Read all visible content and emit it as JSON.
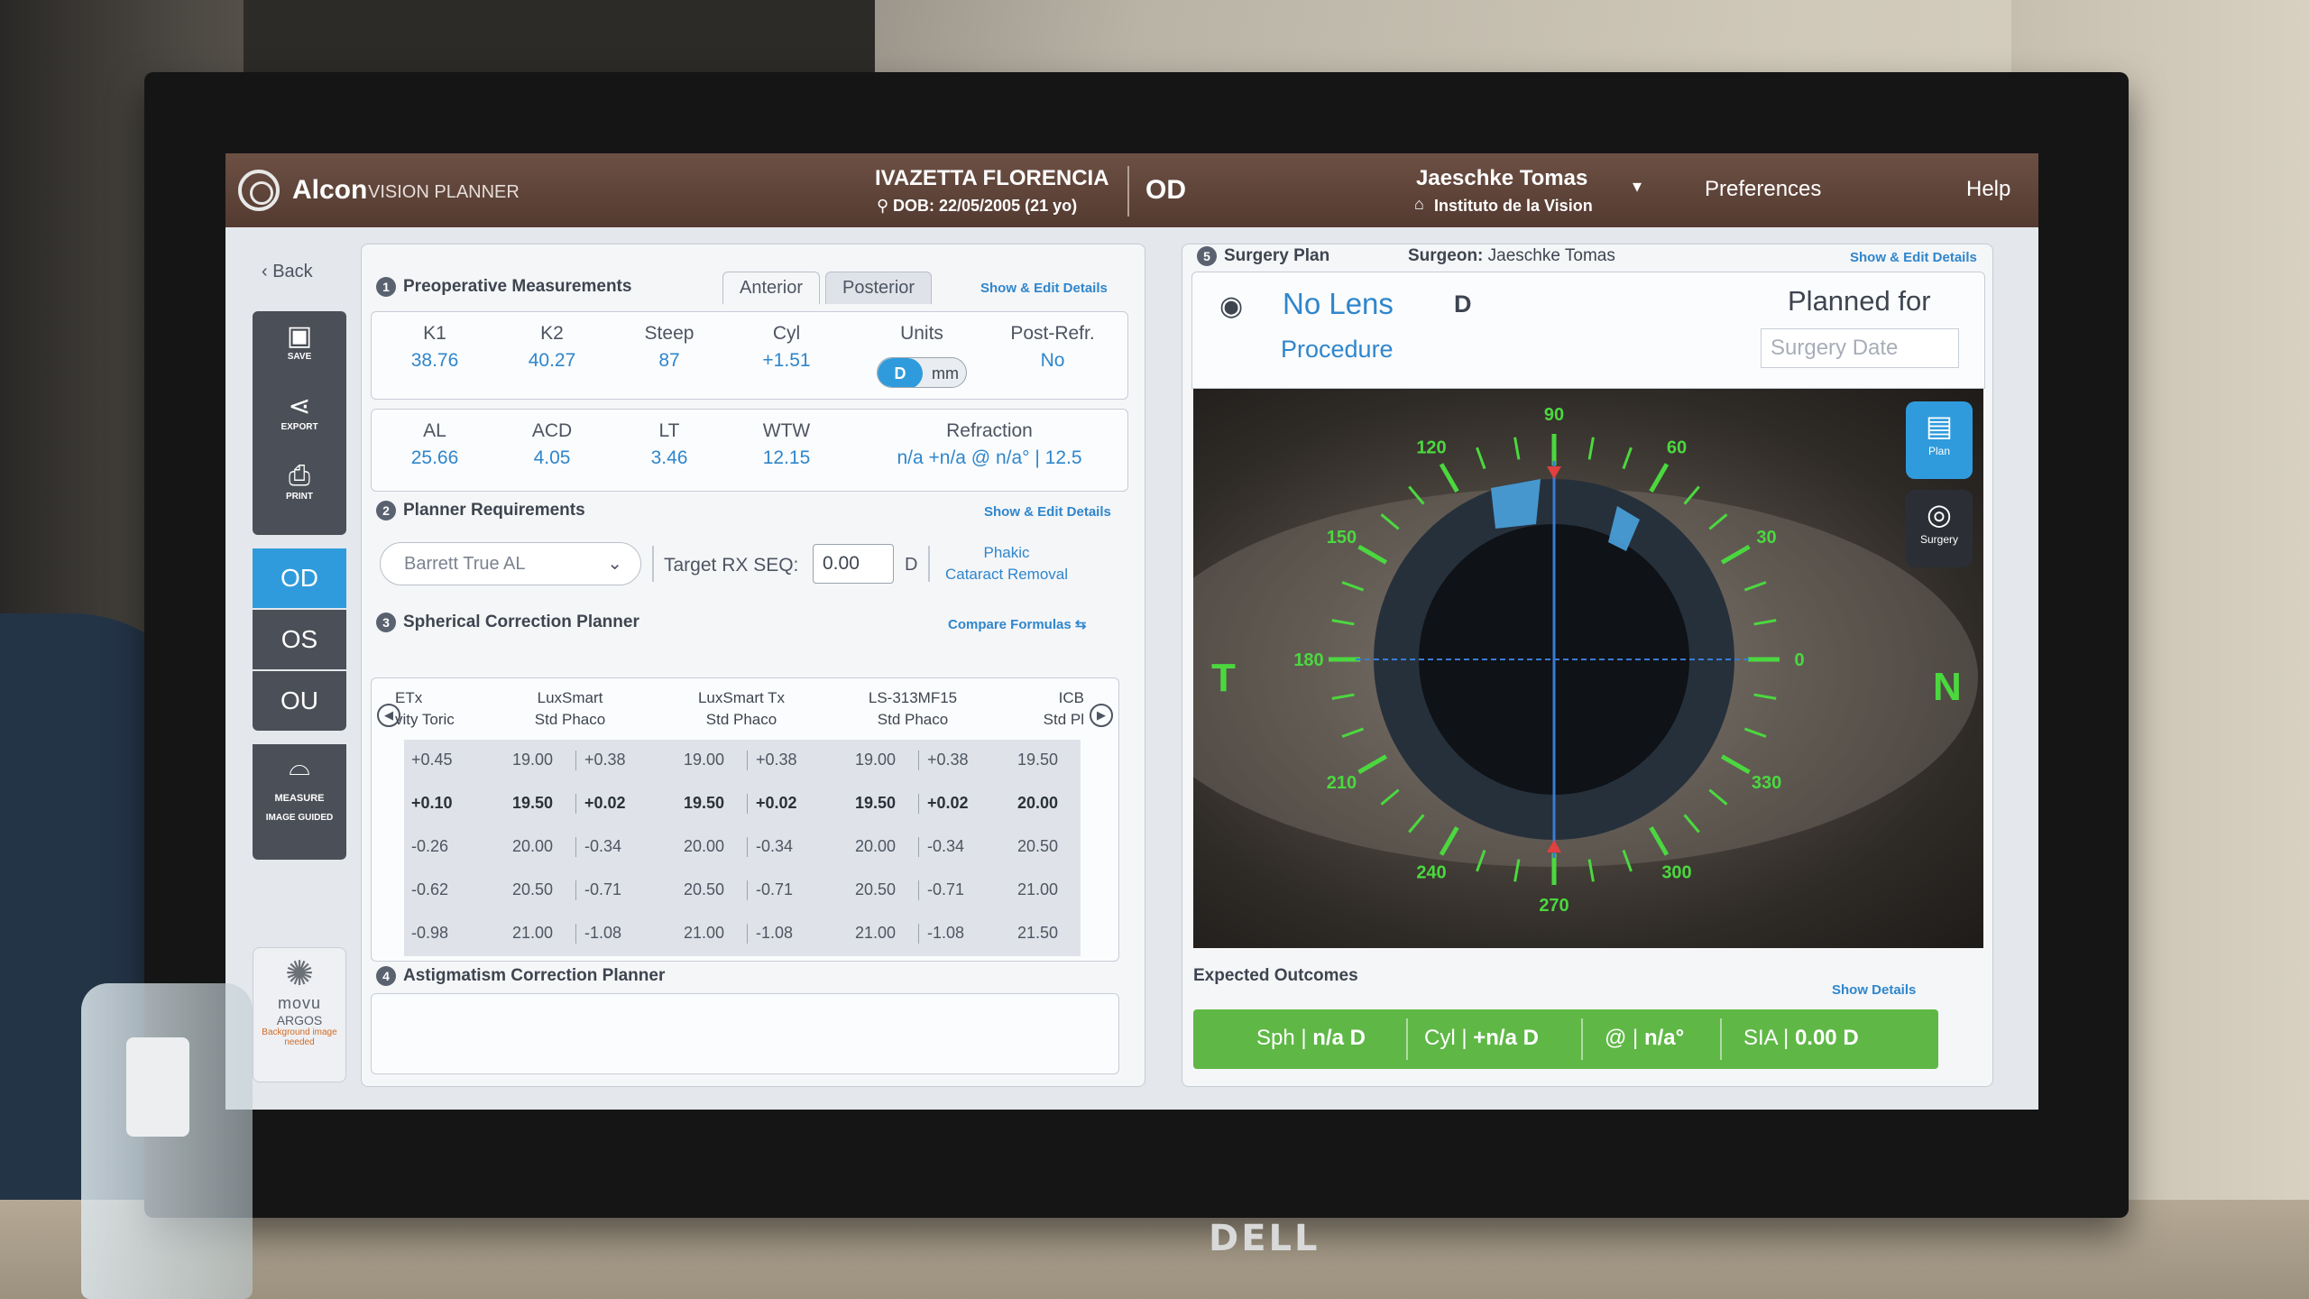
{
  "header": {
    "brand": "Alcon",
    "brand_sub": "VISION PLANNER",
    "patient_name": "IVAZETTA FLORENCIA",
    "patient_dob": "DOB: 22/05/2005 (21 yo)",
    "eye": "OD",
    "surgeon": "Jaeschke Tomas",
    "institute": "Instituto de la Vision",
    "preferences": "Preferences",
    "help": "Help"
  },
  "sidebar": {
    "back": "Back",
    "tools": [
      {
        "label": "SAVE",
        "icon": "save-icon"
      },
      {
        "label": "EXPORT",
        "icon": "share-icon"
      },
      {
        "label": "PRINT",
        "icon": "print-icon"
      }
    ],
    "eyes": [
      "OD",
      "OS",
      "OU"
    ],
    "measure_label": "MEASURE",
    "image_guided_label": "IMAGE GUIDED",
    "movu_name": "movu",
    "movu_sub": "ARGOS",
    "movu_note": "Background image needed"
  },
  "preop": {
    "num": "1",
    "title": "Preoperative Measurements",
    "tabs": [
      "Anterior",
      "Posterior"
    ],
    "link": "Show & Edit Details",
    "row1": [
      {
        "h": "K1",
        "v": "38.76"
      },
      {
        "h": "K2",
        "v": "40.27"
      },
      {
        "h": "Steep",
        "v": "87"
      },
      {
        "h": "Cyl",
        "v": "+1.51"
      },
      {
        "h": "Units",
        "v": ""
      },
      {
        "h": "Post-Refr.",
        "v": "No"
      }
    ],
    "units": {
      "d": "D",
      "mm": "mm"
    },
    "row2": [
      {
        "h": "AL",
        "v": "25.66"
      },
      {
        "h": "ACD",
        "v": "4.05"
      },
      {
        "h": "LT",
        "v": "3.46"
      },
      {
        "h": "WTW",
        "v": "12.15"
      },
      {
        "h": "Refraction",
        "v": "n/a +n/a @ n/a° | 12.5"
      }
    ]
  },
  "planner": {
    "num": "2",
    "title": "Planner Requirements",
    "link": "Show & Edit Details",
    "formula": "Barrett True AL",
    "target_label": "Target RX SEQ:",
    "target_value": "0.00",
    "target_unit": "D",
    "phakic_1": "Phakic",
    "phakic_2": "Cataract Removal"
  },
  "spherical": {
    "num": "3",
    "title": "Spherical Correction Planner",
    "link": "Compare Formulas",
    "headers": [
      [
        "ETx",
        "vity Toric"
      ],
      [
        "LuxSmart",
        "Std Phaco"
      ],
      [
        "LuxSmart Tx",
        "Std Phaco"
      ],
      [
        "LS-313MF15",
        "Std Phaco"
      ],
      [
        "ICB",
        "Std Pl"
      ]
    ],
    "rows": [
      {
        "c0": "+0.45",
        "c1a": "19.00",
        "c1b": "+0.38",
        "c2a": "19.00",
        "c2b": "+0.38",
        "c3a": "19.00",
        "c3b": "+0.38",
        "c4": "19.50"
      },
      {
        "c0": "+0.10",
        "c1a": "19.50",
        "c1b": "+0.02",
        "c2a": "19.50",
        "c2b": "+0.02",
        "c3a": "19.50",
        "c3b": "+0.02",
        "c4": "20.00"
      },
      {
        "c0": "-0.26",
        "c1a": "20.00",
        "c1b": "-0.34",
        "c2a": "20.00",
        "c2b": "-0.34",
        "c3a": "20.00",
        "c3b": "-0.34",
        "c4": "20.50"
      },
      {
        "c0": "-0.62",
        "c1a": "20.50",
        "c1b": "-0.71",
        "c2a": "20.50",
        "c2b": "-0.71",
        "c3a": "20.50",
        "c3b": "-0.71",
        "c4": "21.00"
      },
      {
        "c0": "-0.98",
        "c1a": "21.00",
        "c1b": "-1.08",
        "c2a": "21.00",
        "c2b": "-1.08",
        "c3a": "21.00",
        "c3b": "-1.08",
        "c4": "21.50"
      }
    ]
  },
  "astig": {
    "num": "4",
    "title": "Astigmatism Correction Planner"
  },
  "surgery_plan": {
    "num": "5",
    "title": "Surgery Plan",
    "surgeon_label": "Surgeon:",
    "surgeon": "Jaeschke Tomas",
    "link": "Show & Edit Details",
    "lens": "No Lens",
    "lens_power": "D",
    "procedure": "Procedure",
    "planned_for": "Planned for",
    "surgery_date_placeholder": "Surgery Date",
    "plan_btn": "Plan",
    "surgery_btn": "Surgery",
    "temporal": "T",
    "nasal": "N",
    "axis_labels": [
      "90",
      "60",
      "30",
      "0",
      "330",
      "300",
      "270",
      "240",
      "210",
      "180",
      "150",
      "120"
    ]
  },
  "outcomes": {
    "title": "Expected Outcomes",
    "link": "Show Details",
    "sph_label": "Sph",
    "sph_value": "n/a D",
    "cyl_label": "Cyl",
    "cyl_value": "+n/a D",
    "axis_label": "@",
    "axis_value": "n/a°",
    "sia_label": "SIA",
    "sia_value": "0.00 D"
  },
  "monitor_brand": "DELL"
}
